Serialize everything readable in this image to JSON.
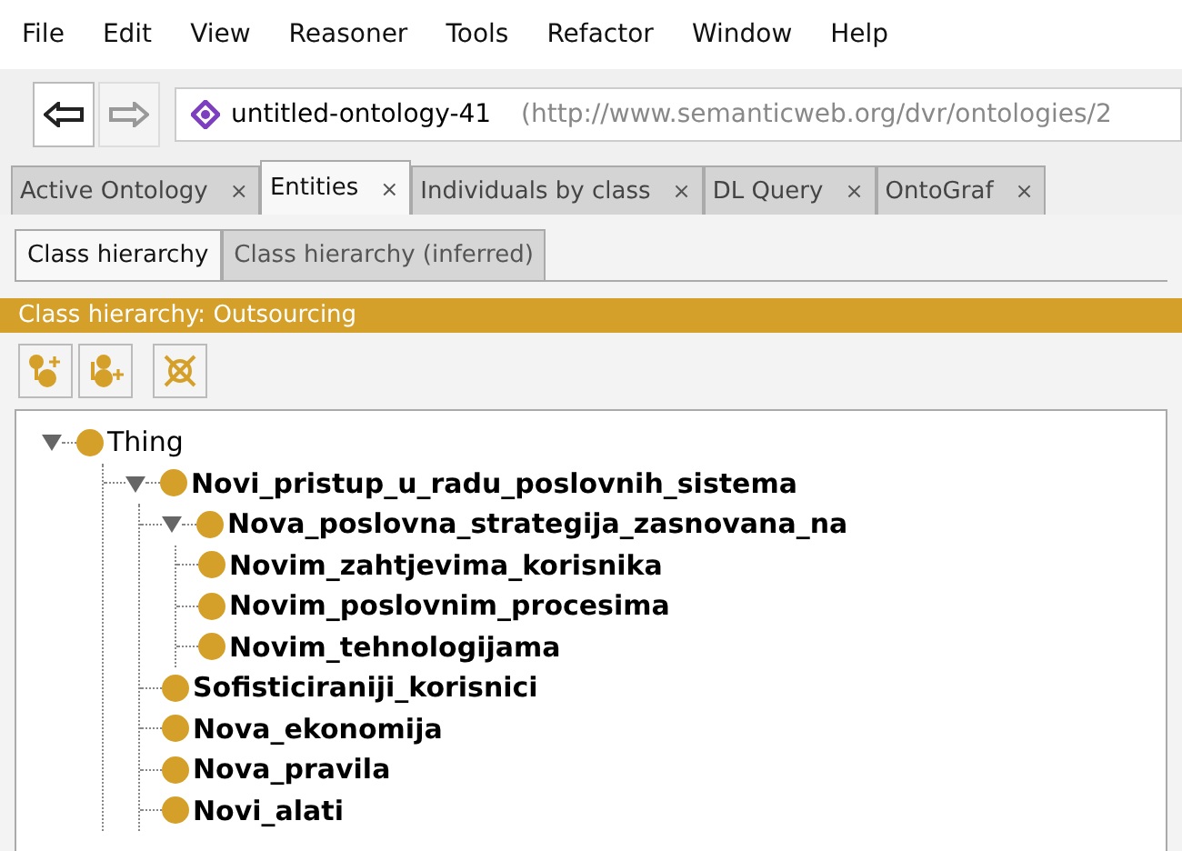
{
  "menu": [
    "File",
    "Edit",
    "View",
    "Reasoner",
    "Tools",
    "Refactor",
    "Window",
    "Help"
  ],
  "address": {
    "name": "untitled-ontology-41",
    "iri": "(http://www.semanticweb.org/dvr/ontologies/2"
  },
  "tabs": [
    {
      "label": "Active Ontology",
      "close": "×",
      "selected": false
    },
    {
      "label": "Entities",
      "close": "×",
      "selected": true
    },
    {
      "label": "Individuals by class",
      "close": "×",
      "selected": false
    },
    {
      "label": "DL Query",
      "close": "×",
      "selected": false
    },
    {
      "label": "OntoGraf",
      "close": "×",
      "selected": false
    }
  ],
  "subtabs": [
    {
      "label": "Class hierarchy",
      "selected": true
    },
    {
      "label": "Class hierarchy (inferred)",
      "selected": false
    }
  ],
  "panel_title": "Class hierarchy: Outsourcing",
  "tree": [
    {
      "label": "Thing",
      "expanded": true,
      "children": [
        {
          "label": "Novi_pristup_u_radu_poslovnih_sistema",
          "expanded": true,
          "children": [
            {
              "label": "Nova_poslovna_strategija_zasnovana_na",
              "expanded": true,
              "children": [
                {
                  "label": "Novim_zahtjevima_korisnika"
                },
                {
                  "label": "Novim_poslovnim_procesima"
                },
                {
                  "label": "Novim_tehnologijama"
                }
              ]
            },
            {
              "label": "Sofisticiraniji_korisnici"
            },
            {
              "label": "Nova_ekonomija"
            },
            {
              "label": "Nova_pravila"
            },
            {
              "label": "Novi_alati"
            }
          ]
        }
      ]
    }
  ]
}
